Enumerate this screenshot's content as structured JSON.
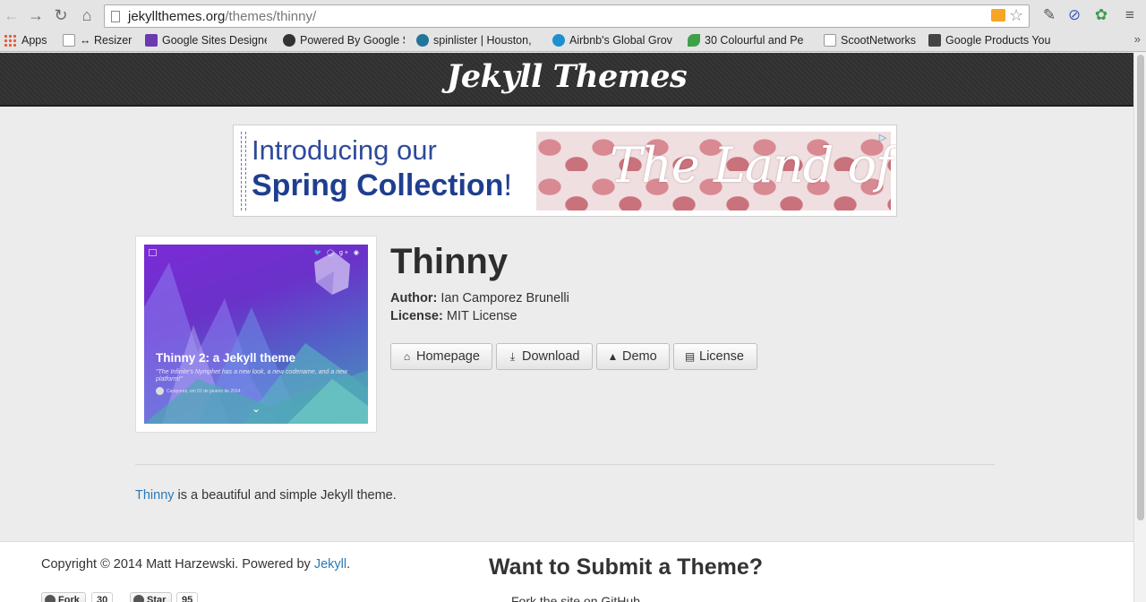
{
  "browser": {
    "url_host": "jekyllthemes.org",
    "url_path": "/themes/thinny/",
    "bookmarks": [
      {
        "label": "Apps"
      },
      {
        "label": "↔ Resizer"
      },
      {
        "label": "Google Sites Designe"
      },
      {
        "label": "Powered By Google S"
      },
      {
        "label": "spinlister | Houston,"
      },
      {
        "label": "Airbnb's Global Grov"
      },
      {
        "label": "30 Colourful and Pe"
      },
      {
        "label": "ScootNetworks"
      },
      {
        "label": "Google Products You"
      }
    ],
    "bookmarks_more": "»"
  },
  "header": {
    "site_title": "Jekyll Themes"
  },
  "ad": {
    "line1": "Introducing our",
    "line2": "Spring Collection",
    "line2_suffix": "!",
    "brand": "The Land of Nod",
    "brand_mark": "®",
    "choice_icon": "adchoices-icon"
  },
  "theme": {
    "name": "Thinny",
    "author_label": "Author:",
    "author": "Ian Camporez Brunelli",
    "license_label": "License:",
    "license": "MIT License",
    "thumbnail": {
      "title": "Thinny 2: a Jekyll theme",
      "quote": "\"The Infinite's Nymphet has a new look, a new codename, and a new platform!\"",
      "meta": "Camporez, em 02 de janeiro de 2014",
      "social": "🐦 ◯ g+ ◉"
    },
    "buttons": [
      {
        "label": "Homepage",
        "icon": "home-icon"
      },
      {
        "label": "Download",
        "icon": "download-icon"
      },
      {
        "label": "Demo",
        "icon": "demo-icon"
      },
      {
        "label": "License",
        "icon": "file-icon"
      }
    ],
    "description_link": "Thinny",
    "description_rest": " is a beautiful and simple Jekyll theme."
  },
  "footer": {
    "copyright_prefix": "Copyright © 2014 Matt Harzewski. Powered by ",
    "copyright_link": "Jekyll",
    "copyright_suffix": ".",
    "fork_label": "Fork",
    "fork_count": "30",
    "star_label": "Star",
    "star_count": "95",
    "submit_title": "Want to Submit a Theme?",
    "submit_line": "Fork the site on GitHub"
  },
  "colors": {
    "link": "#2a7ab8",
    "header_bg": "#333333",
    "ad_blue": "#1e3e8f"
  }
}
